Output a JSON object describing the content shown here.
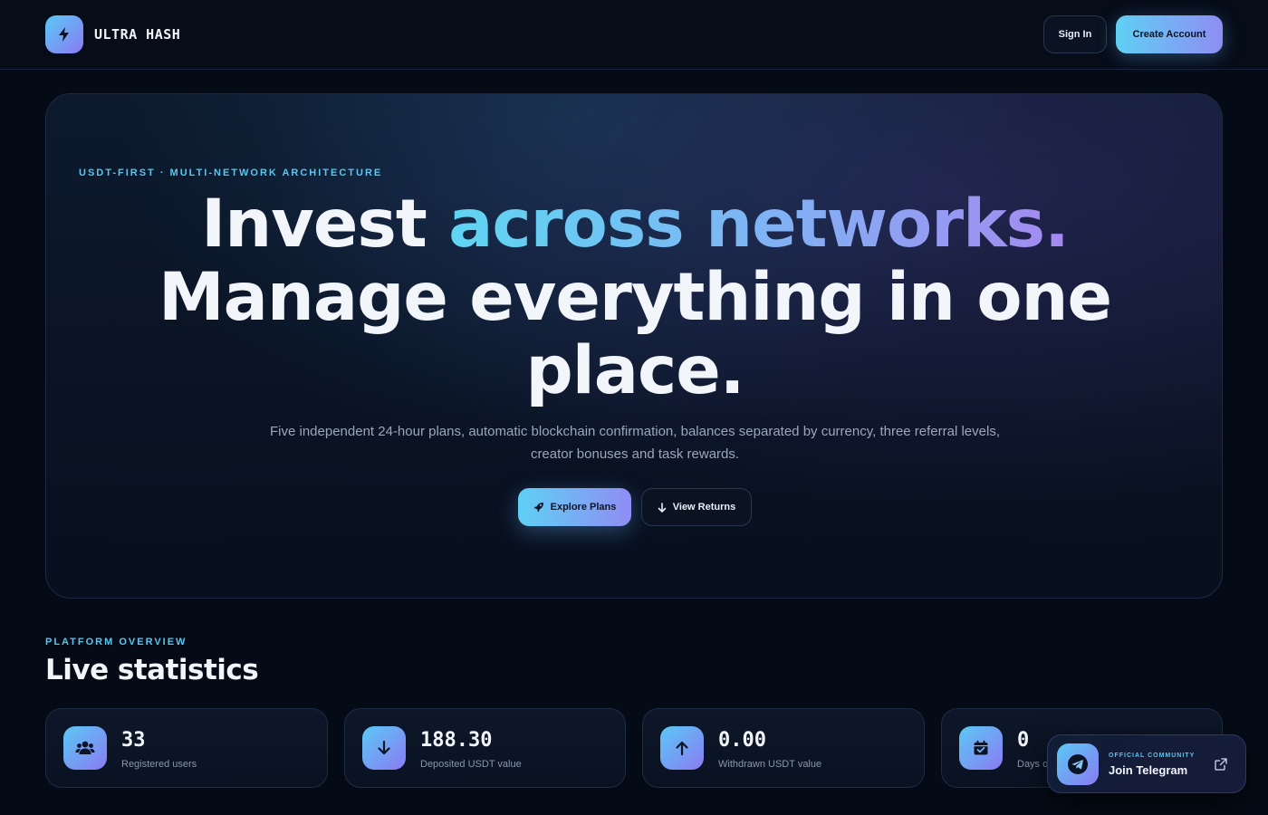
{
  "header": {
    "brand": "ULTRA HASH",
    "sign_in": "Sign In",
    "create_account": "Create Account",
    "logo_icon": "lightning-icon"
  },
  "hero": {
    "eyebrow": "USDT-FIRST · MULTI-NETWORK ARCHITECTURE",
    "title_part1": "Invest ",
    "title_highlight": "across networks.",
    "title_part2": "Manage everything in one place.",
    "subtitle": "Five independent 24-hour plans, automatic blockchain confirmation, balances separated by currency, three referral levels, creator bonuses and task rewards.",
    "explore_label": "Explore Plans",
    "returns_label": "View Returns"
  },
  "stats": {
    "eyebrow": "PLATFORM OVERVIEW",
    "title": "Live statistics",
    "items": [
      {
        "value": "33",
        "label": "Registered users",
        "icon": "users-icon"
      },
      {
        "value": "188.30",
        "label": "Deposited USDT value",
        "icon": "arrow-down-icon"
      },
      {
        "value": "0.00",
        "label": "Withdrawn USDT value",
        "icon": "arrow-up-icon"
      },
      {
        "value": "0",
        "label": "Days o",
        "icon": "calendar-check-icon"
      }
    ]
  },
  "telegram": {
    "eyebrow": "OFFICIAL COMMUNITY",
    "title": "Join Telegram"
  },
  "colors": {
    "accent_cyan": "#5fd0f4",
    "accent_violet": "#8f8df3",
    "background": "#050b16"
  }
}
